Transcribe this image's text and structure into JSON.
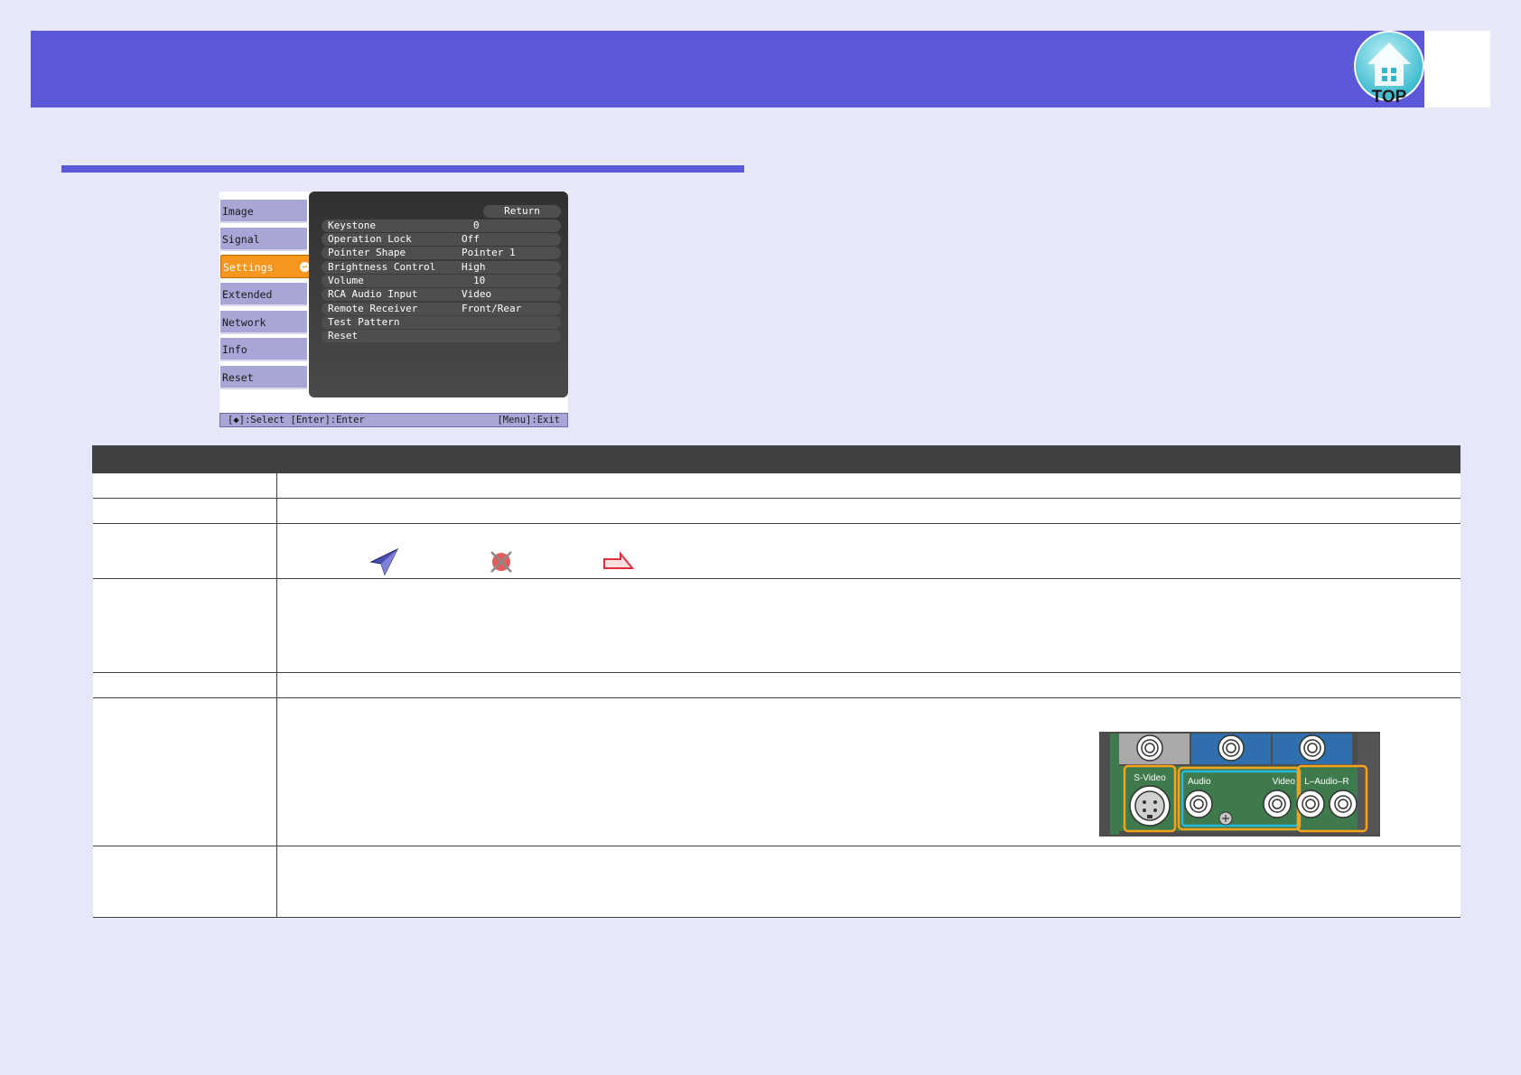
{
  "header": {
    "top_logo_text": "TOP",
    "logo_icon": "home-icon"
  },
  "menu": {
    "side_items": [
      {
        "label": "Image",
        "active": false
      },
      {
        "label": "Signal",
        "active": false
      },
      {
        "label": "Settings",
        "active": true
      },
      {
        "label": "Extended",
        "active": false
      },
      {
        "label": "Network",
        "active": false
      },
      {
        "label": "Info",
        "active": false
      },
      {
        "label": "Reset",
        "active": false
      }
    ],
    "return_label": "Return",
    "rows": [
      {
        "label": "Keystone",
        "value": "0"
      },
      {
        "label": "Operation Lock",
        "value": "Off"
      },
      {
        "label": "Pointer Shape",
        "value": "Pointer 1"
      },
      {
        "label": "Brightness Control",
        "value": "High"
      },
      {
        "label": "Volume",
        "value": "10"
      },
      {
        "label": "RCA Audio Input",
        "value": "Video"
      },
      {
        "label": "Remote Receiver",
        "value": "Front/Rear"
      },
      {
        "label": "Test Pattern",
        "value": ""
      },
      {
        "label": "Reset",
        "value": ""
      }
    ],
    "footer_left": "[◆]:Select [Enter]:Enter",
    "footer_right": "[Menu]:Exit"
  },
  "connector": {
    "svideo": "S-Video",
    "audio": "Audio",
    "video": "Video",
    "lr_audio": "L–Audio–R"
  },
  "colors": {
    "accent": "#5b58da",
    "menu_active": "#f7961d",
    "menu_item": "#a8a6d6",
    "table_header": "#404040"
  }
}
